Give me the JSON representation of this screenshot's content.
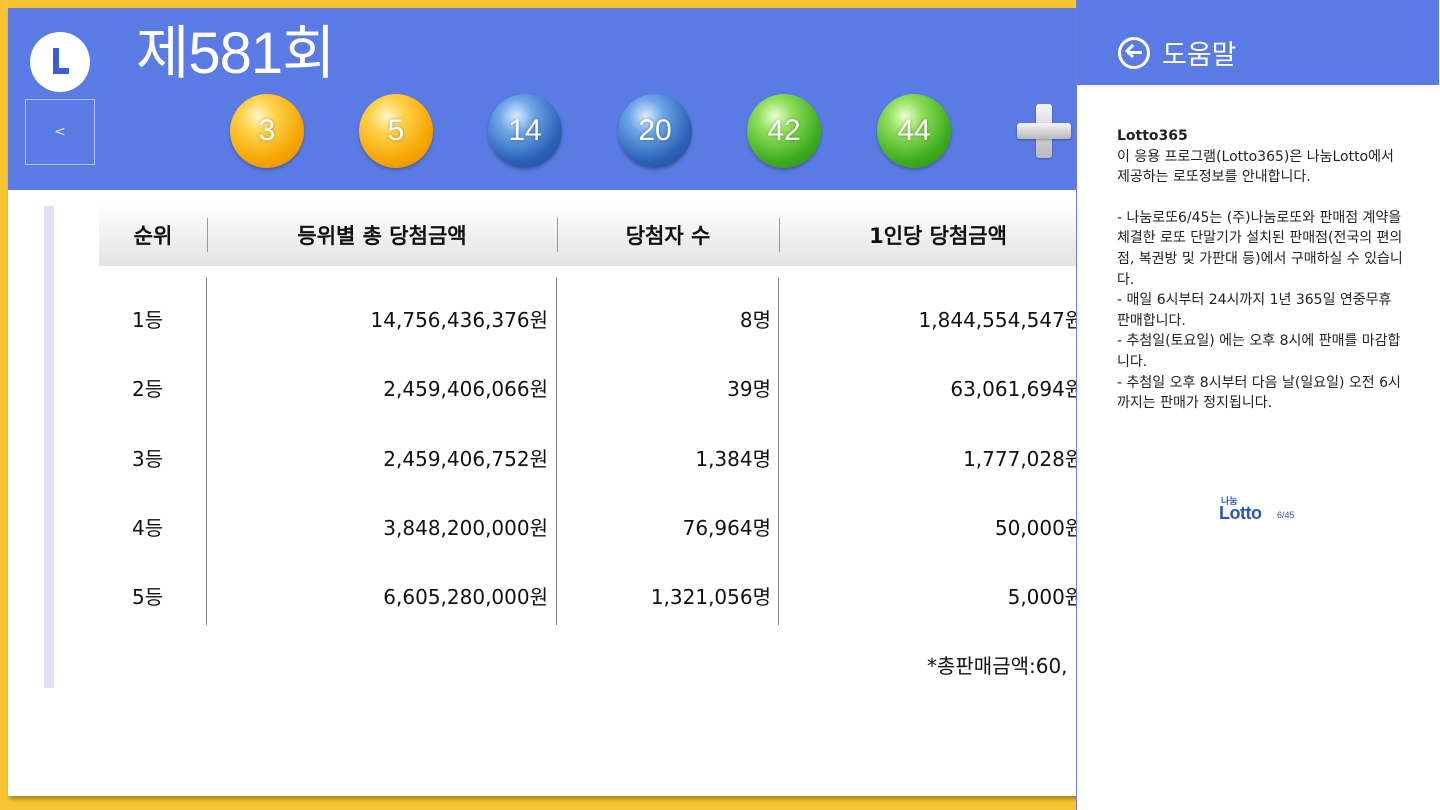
{
  "header": {
    "round_prefix": "제",
    "round_number": "581",
    "round_suffix": "회",
    "prev_label": "<"
  },
  "balls": [
    {
      "number": "3",
      "color": "yellow"
    },
    {
      "number": "5",
      "color": "yellow"
    },
    {
      "number": "14",
      "color": "blue"
    },
    {
      "number": "20",
      "color": "blue"
    },
    {
      "number": "42",
      "color": "green"
    },
    {
      "number": "44",
      "color": "green"
    }
  ],
  "table": {
    "headers": [
      "순위",
      "등위별 총 당첨금액",
      "당첨자 수",
      "1인당 당첨금액"
    ],
    "rows": [
      {
        "rank": "1등",
        "total": "14,756,436,376원",
        "winners": "8명",
        "per_person": "1,844,554,547원/"
      },
      {
        "rank": "2등",
        "total": "2,459,406,066원",
        "winners": "39명",
        "per_person": "63,061,694원/"
      },
      {
        "rank": "3등",
        "total": "2,459,406,752원",
        "winners": "1,384명",
        "per_person": "1,777,028원/"
      },
      {
        "rank": "4등",
        "total": "3,848,200,000원",
        "winners": "76,964명",
        "per_person": "50,000원/"
      },
      {
        "rank": "5등",
        "total": "6,605,280,000원",
        "winners": "1,321,056명",
        "per_person": "5,000원/"
      }
    ],
    "footer": "*총판매금액:60,"
  },
  "help": {
    "title": "도움말",
    "app_name": "Lotto365",
    "intro": "이 응용 프로그램(Lotto365)은 나눔Lotto에서 제공하는 로또정보를 안내합니다.",
    "items": [
      "- 나눔로또6/45는 (주)나눔로또와 판매점 계약을 체결한 로또 단말기가 설치된 판매점(전국의 편의점, 복권방 및 가판대 등)에서 구매하실 수 있습니다.",
      "- 매일 6시부터 24시까지 1년 365일 연중무휴 판매합니다.",
      "- 추첨일(토요일) 에는 오후 8시에 판매를 마감합니다.",
      "- 추첨일 오후 8시부터 다음 날(일요일) 오전 6시까지는 판매가 정지됩니다."
    ],
    "logo": {
      "nanum": "나눔",
      "lotto": "Lotto",
      "version": "6/45"
    }
  },
  "colors": {
    "header_bg": "#5b7be4",
    "frame": "#f7c531"
  }
}
